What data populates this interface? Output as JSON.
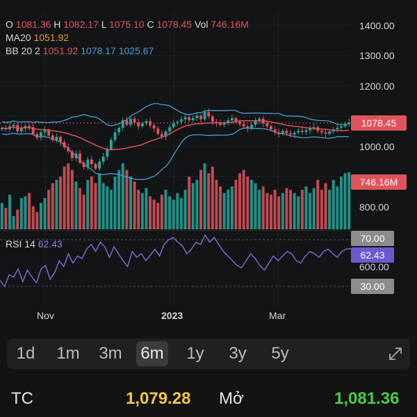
{
  "legend": {
    "ohlc_o_label": "O",
    "ohlc_o": "1081.36",
    "ohlc_h_label": "H",
    "ohlc_h": "1082.17",
    "ohlc_l_label": "L",
    "ohlc_l": "1075.10",
    "ohlc_c_label": "C",
    "ohlc_c": "1078.45",
    "vol_label": "Vol",
    "vol": "746.16M",
    "ma_label": "MA20",
    "ma_value": "1051.92",
    "bb_label": "BB 20 2",
    "bb_mid": "1051.92",
    "bb_upper": "1078.17",
    "bb_lower": "1025.67",
    "rsi_label": "RSI 14",
    "rsi_value": "62.43"
  },
  "y_axis": {
    "ticks": [
      "1400.00",
      "1300.00",
      "1200.00",
      "1000.00",
      "800.00",
      "600.00"
    ],
    "price_tag": "1078.45",
    "volume_tag": "746.16M",
    "rsi_upper": "70.00",
    "rsi_current": "62.43",
    "rsi_lower": "30.00"
  },
  "x_axis": {
    "ticks": [
      "Nov",
      "2023",
      "Mar"
    ]
  },
  "range_selector": {
    "options": [
      "1d",
      "1m",
      "3m",
      "6m",
      "1y",
      "3y",
      "5y"
    ],
    "selected": "6m"
  },
  "stats": {
    "tc_label": "TC",
    "tc_value": "1,079.28",
    "open_label": "Mở",
    "open_value": "1,081.36"
  },
  "colors": {
    "up": "#26a69a",
    "down": "#e0535c",
    "ma": "#e0535c",
    "bb": "#4d9ed6",
    "rsi": "#7e6fd6",
    "tc_value": "#f2c744",
    "open_value": "#4cc94a"
  },
  "chart_data": {
    "type": "candlestick",
    "price_range": [
      800,
      1450
    ],
    "price_ticks": [
      1400,
      1300,
      1200,
      1000,
      800
    ],
    "series": [
      {
        "name": "Close",
        "values": [
          1060,
          1055,
          1065,
          1070,
          1048,
          1058,
          1066,
          1062,
          1040,
          1028,
          1045,
          1052,
          1035,
          1020,
          1030,
          1012,
          995,
          982,
          960,
          975,
          945,
          930,
          955,
          940,
          925,
          948,
          965,
          990,
          1020,
          1045,
          1060,
          1085,
          1070,
          1090,
          1078,
          1065,
          1075,
          1082,
          1068,
          1058,
          1040,
          1030,
          1048,
          1062,
          1075,
          1080,
          1088,
          1095,
          1085,
          1092,
          1100,
          1088,
          1112,
          1098,
          1080,
          1075,
          1070,
          1078,
          1085,
          1092,
          1080,
          1072,
          1065,
          1058,
          1070,
          1082,
          1090,
          1075,
          1065,
          1055,
          1045,
          1040,
          1050,
          1042,
          1038,
          1044,
          1050,
          1046,
          1052,
          1058,
          1062,
          1050,
          1045,
          1040,
          1048,
          1055,
          1060,
          1065,
          1072,
          1078
        ]
      },
      {
        "name": "Volume (M)",
        "values": [
          560,
          530,
          610,
          480,
          520,
          590,
          600,
          620,
          540,
          505,
          560,
          590,
          640,
          680,
          700,
          720,
          780,
          800,
          760,
          690,
          650,
          610,
          700,
          720,
          680,
          740,
          680,
          660,
          640,
          720,
          760,
          800,
          760,
          720,
          690,
          640,
          620,
          650,
          600,
          580,
          560,
          610,
          640,
          600,
          580,
          620,
          590,
          640,
          720,
          680,
          700,
          760,
          800,
          740,
          780,
          700,
          660,
          620,
          640,
          660,
          700,
          740,
          760,
          720,
          700,
          680,
          640,
          660,
          620,
          610,
          640,
          600,
          620,
          650,
          640,
          620,
          600,
          640,
          660,
          620,
          650,
          700,
          640,
          680,
          640,
          700,
          660,
          720,
          740,
          746
        ]
      },
      {
        "name": "RSI 14",
        "values": [
          35,
          30,
          40,
          38,
          45,
          34,
          44,
          38,
          33,
          45,
          48,
          36,
          42,
          52,
          47,
          58,
          50,
          56,
          54,
          62,
          66,
          60,
          68,
          64,
          55,
          64,
          58,
          52,
          47,
          60,
          55,
          58,
          52,
          57,
          62,
          56,
          66,
          70,
          72,
          68,
          65,
          58,
          62,
          68,
          66,
          74,
          68,
          72,
          66,
          60,
          56,
          52,
          48,
          46,
          52,
          58,
          54,
          48,
          44,
          50,
          56,
          52,
          56,
          60,
          58,
          52,
          50,
          56,
          60,
          58,
          55,
          60,
          62,
          58,
          55,
          60,
          62,
          62.43
        ]
      }
    ]
  }
}
